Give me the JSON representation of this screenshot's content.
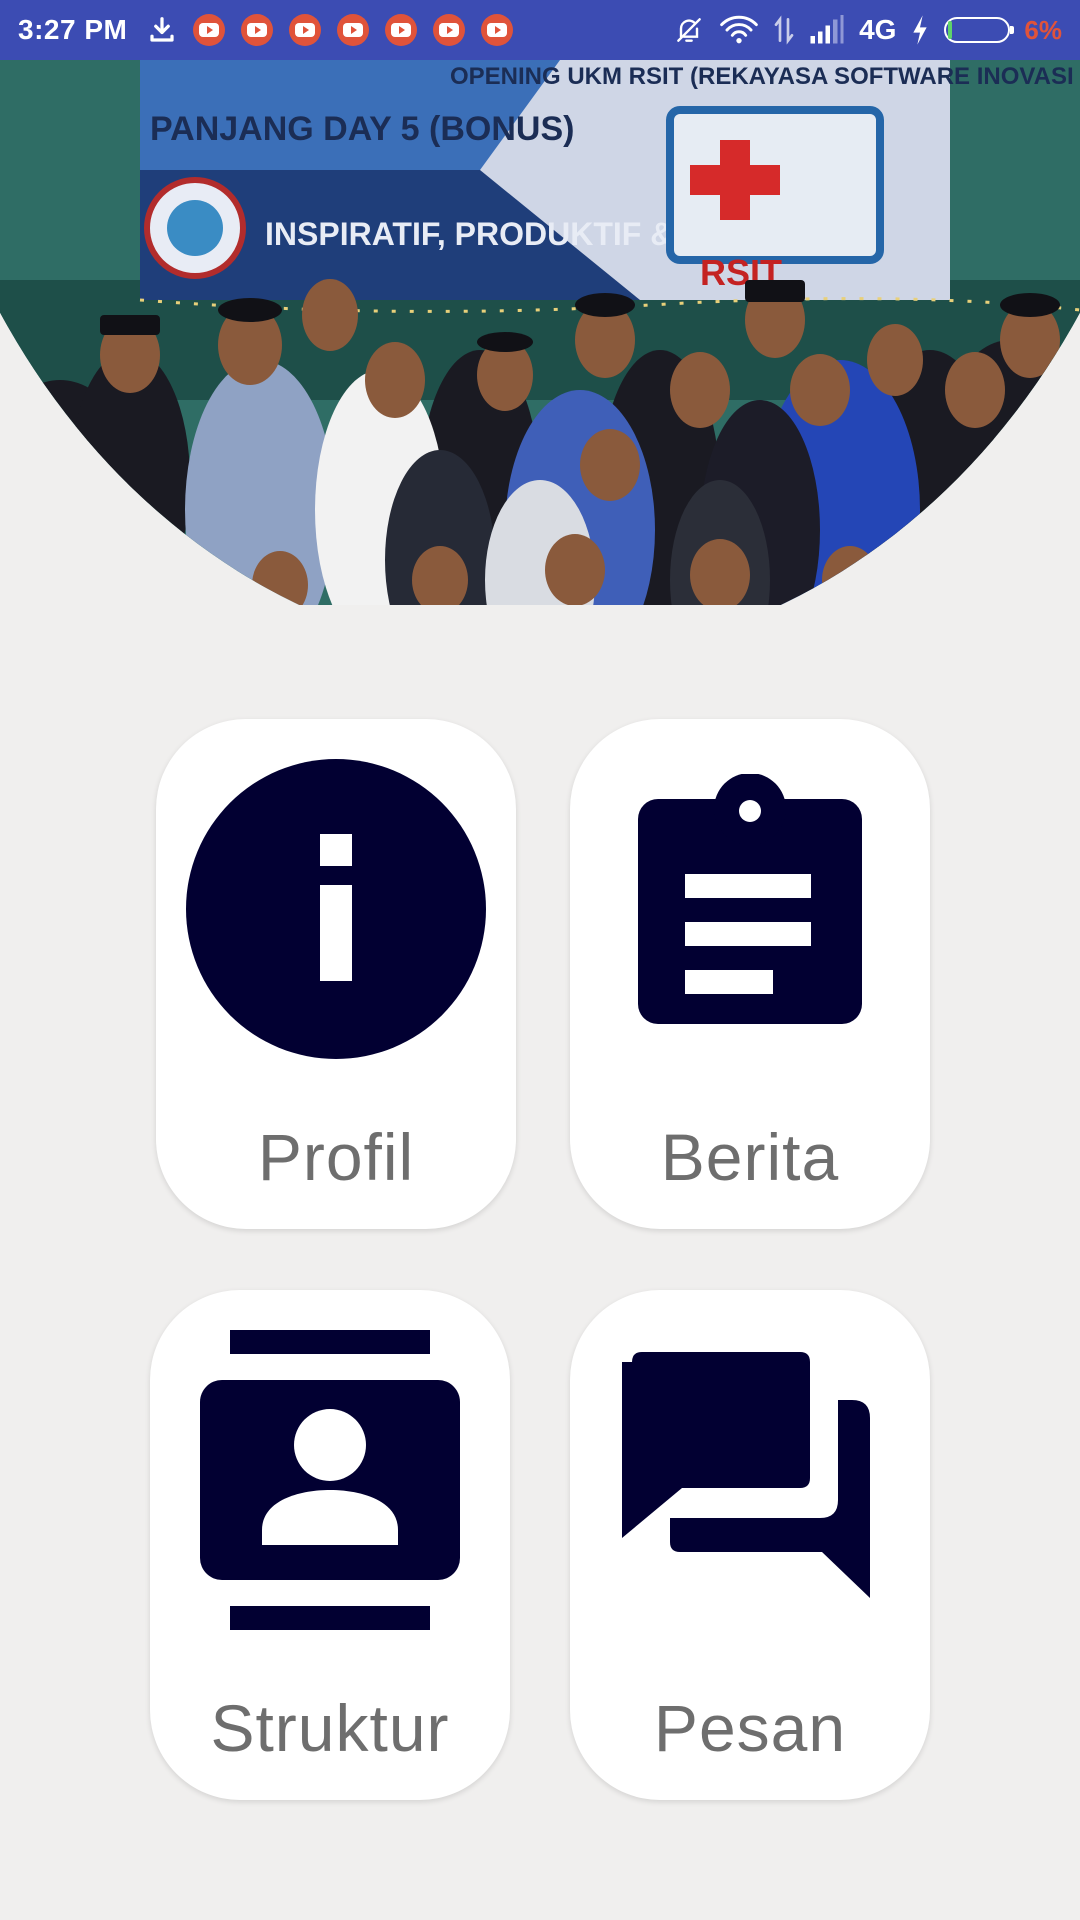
{
  "status_bar": {
    "time": "3:27 PM",
    "network": "4G",
    "battery_percent_label": "6%",
    "battery_level": 0.06,
    "left_icons": [
      "download-icon",
      "youtube-icon",
      "youtube-icon",
      "youtube-icon",
      "youtube-icon",
      "youtube-icon",
      "youtube-icon",
      "youtube-icon"
    ],
    "right_icons": [
      "bell-muted-icon",
      "wifi-icon",
      "data-transfer-icon",
      "signal-icon",
      "charging-bolt-icon",
      "battery-icon"
    ],
    "color": "#3c4cb3"
  },
  "hero": {
    "image": "group-photo",
    "banner_lines": [
      "OPENING UKM RSIT (REKAYASA SOFTWARE INOVASI TEKNOLOGI)",
      "INSPIRATIF, PRODUKTIF & KREATIV",
      "PANJANG DAY 5 (BONUS)",
      "RSIT"
    ]
  },
  "menu": {
    "icon_color": "#020032",
    "label_color": "#6e6e6e",
    "items": [
      {
        "label": "Profil",
        "icon": "info-circle-icon"
      },
      {
        "label": "Berita",
        "icon": "clipboard-icon"
      },
      {
        "label": "Struktur",
        "icon": "contacts-icon"
      },
      {
        "label": "Pesan",
        "icon": "forum-chat-icon"
      }
    ]
  }
}
